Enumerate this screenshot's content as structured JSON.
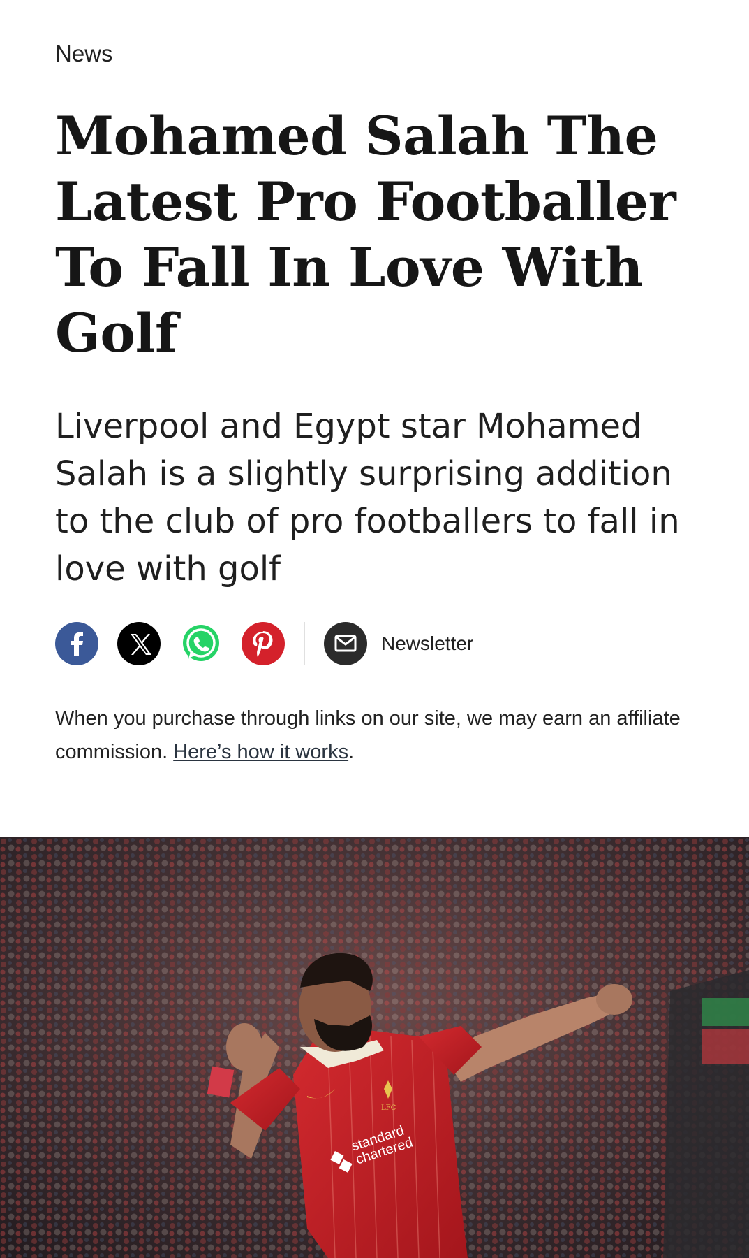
{
  "article": {
    "category": "News",
    "headline": "Mohamed Salah The Latest Pro Footballer To Fall In Love With Golf",
    "standfirst": "Liverpool and Egypt star Mohamed Salah is a slightly surprising addition to the club of pro footballers to fall in love with golf"
  },
  "share": {
    "buttons": [
      {
        "name": "facebook",
        "icon": "facebook-icon",
        "color": "#3b5998"
      },
      {
        "name": "x",
        "icon": "x-icon",
        "color": "#000000"
      },
      {
        "name": "whatsapp",
        "icon": "whatsapp-icon",
        "color": "#25d366"
      },
      {
        "name": "pinterest",
        "icon": "pinterest-icon",
        "color": "#d4212b"
      }
    ],
    "newsletter_label": "Newsletter"
  },
  "disclaimer": {
    "text": "When you purchase through links on our site, we may earn an affiliate commission. ",
    "link_text": "Here’s how it works",
    "end": "."
  },
  "hero_image": {
    "shirt_text_1": "standard",
    "shirt_text_2": "chartered",
    "crest_text": "LFC"
  }
}
